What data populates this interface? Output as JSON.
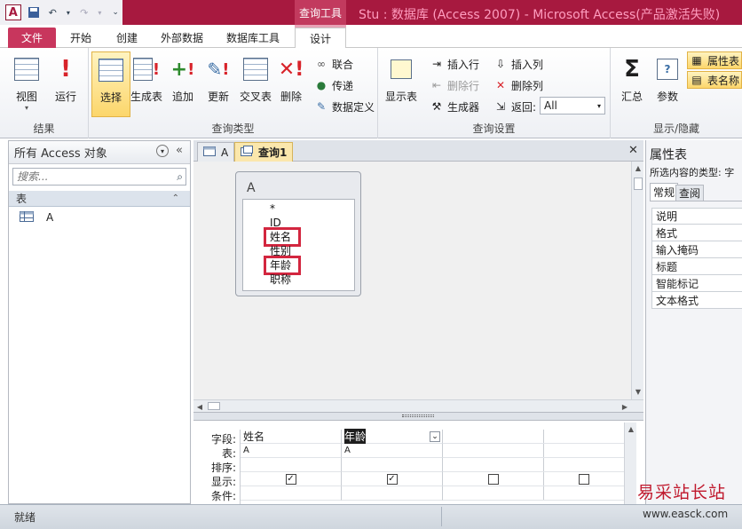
{
  "titlebar": {
    "app_logo": "A",
    "context_tab_title": "查询工具",
    "window_title": "Stu : 数据库 (Access 2007) - Microsoft Access(产品激活失败)"
  },
  "ribbon_tabs": [
    "文件",
    "开始",
    "创建",
    "外部数据",
    "数据库工具",
    "设计"
  ],
  "active_tab": "设计",
  "ribbon": {
    "groups": {
      "results": "结果",
      "query_type": "查询类型",
      "query_setup": "查询设置",
      "show_hide": "显示/隐藏"
    },
    "buttons": {
      "view": "视图",
      "run": "运行",
      "select": "选择",
      "make_table": "生成表",
      "append": "追加",
      "update": "更新",
      "crosstab": "交叉表",
      "delete": "删除",
      "union": "联合",
      "pass_through": "传递",
      "data_definition": "数据定义",
      "show_table": "显示表",
      "insert_rows": "插入行",
      "delete_rows": "删除行",
      "builder": "生成器",
      "insert_columns": "插入列",
      "delete_columns": "删除列",
      "return_label": "返回:",
      "return_value": "All",
      "totals": "汇总",
      "parameters": "参数",
      "property_sheet": "属性表",
      "table_names": "表名称"
    }
  },
  "nav_pane": {
    "title": "所有 Access 对象",
    "search_placeholder": "搜索...",
    "group": "表",
    "items": [
      "A"
    ]
  },
  "doc_tabs": [
    "A",
    "查询1"
  ],
  "table_box": {
    "name": "A",
    "fields": [
      "*",
      "ID",
      "姓名",
      "性别",
      "年龄",
      "职称"
    ]
  },
  "grid": {
    "row_labels": [
      "字段:",
      "表:",
      "排序:",
      "显示:",
      "条件:"
    ],
    "columns": [
      {
        "field": "姓名",
        "table": "A",
        "show": true
      },
      {
        "field": "年龄",
        "table": "A",
        "show": true
      },
      {
        "field": "",
        "table": "",
        "show": false
      },
      {
        "field": "",
        "table": "",
        "show": false
      }
    ]
  },
  "property_sheet": {
    "title": "属性表",
    "selection_type": "所选内容的类型: 字",
    "tabs": [
      "常规",
      "查阅"
    ],
    "properties": [
      "说明",
      "格式",
      "输入掩码",
      "标题",
      "智能标记",
      "文本格式"
    ]
  },
  "status": {
    "text": "就绪"
  },
  "watermark": {
    "name": "易采站长站",
    "url": "www.easck.com"
  },
  "colors": {
    "brand": "#a7193f",
    "highlight": "#d3263f",
    "selected": "#fcd66b"
  }
}
